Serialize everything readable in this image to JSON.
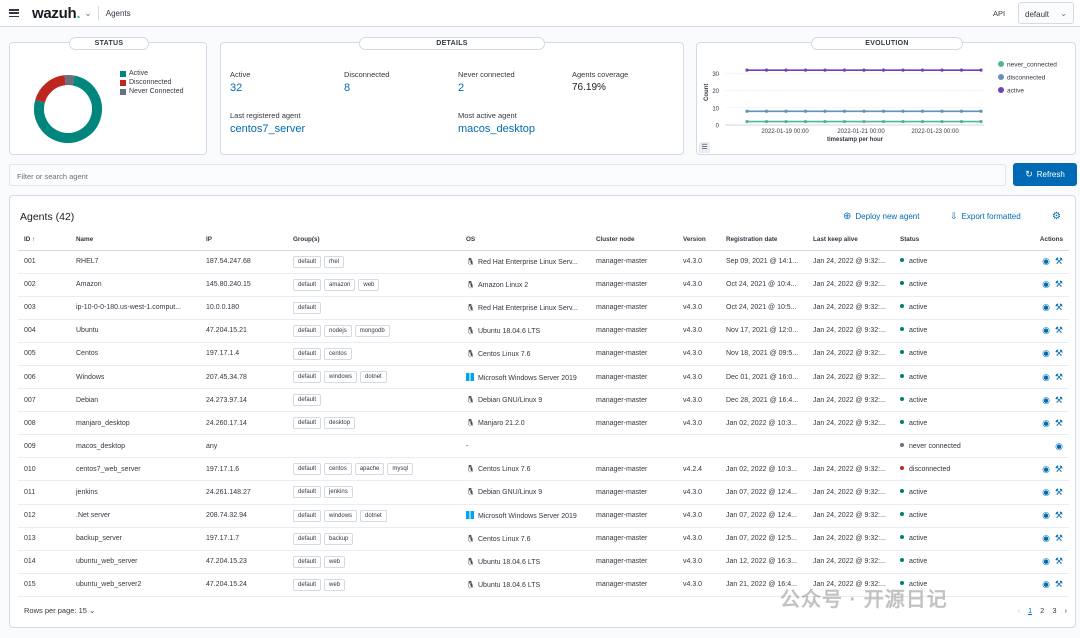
{
  "topbar": {
    "logo_text": "wazuh",
    "logo_dot": ".",
    "breadcrumb": "Agents",
    "api_label": "API",
    "api_value": "default"
  },
  "status": {
    "title": "STATUS",
    "legend": [
      {
        "label": "Active",
        "color": "#00867d",
        "value": 32
      },
      {
        "label": "Disconnected",
        "color": "#bd271e",
        "value": 8
      },
      {
        "label": "Never Connected",
        "color": "#69707d",
        "value": 2
      }
    ]
  },
  "details": {
    "title": "DETAILS",
    "active_label": "Active",
    "active_value": "32",
    "disconnected_label": "Disconnected",
    "disconnected_value": "8",
    "never_label": "Never connected",
    "never_value": "2",
    "coverage_label": "Agents coverage",
    "coverage_value": "76.19%",
    "last_label": "Last registered agent",
    "last_value": "centos7_server",
    "most_label": "Most active agent",
    "most_value": "macos_desktop"
  },
  "evolution": {
    "title": "EVOLUTION",
    "chart_data": {
      "type": "line",
      "ylabel": "Count",
      "xlabel": "timestamp per hour",
      "yticks": [
        0,
        10,
        20,
        30
      ],
      "xticks": [
        "2022-01-19 00:00",
        "2022-01-21 00:00",
        "2022-01-23 00:00"
      ],
      "legend_placement": "right",
      "series": [
        {
          "name": "never_connected",
          "color": "#54b399",
          "values": [
            2,
            2,
            2,
            2,
            2,
            2,
            2,
            2,
            2,
            2,
            2,
            2,
            2
          ]
        },
        {
          "name": "disconnected",
          "color": "#6092c0",
          "values": [
            8,
            8,
            8,
            8,
            8,
            8,
            8,
            8,
            8,
            8,
            8,
            8,
            8
          ]
        },
        {
          "name": "active",
          "color": "#7040b7",
          "values": [
            32,
            32,
            32,
            32,
            32,
            32,
            32,
            32,
            32,
            32,
            32,
            32,
            32
          ]
        }
      ]
    }
  },
  "search": {
    "placeholder": "Filter or search agent"
  },
  "refresh_label": "Refresh",
  "agents": {
    "title": "Agents (42)",
    "deploy_label": "Deploy new agent",
    "export_label": "Export formatted",
    "columns": [
      "ID",
      "Name",
      "IP",
      "Group(s)",
      "OS",
      "Cluster node",
      "Version",
      "Registration date",
      "Last keep alive",
      "Status",
      "Actions"
    ],
    "rows": [
      {
        "id": "001",
        "name": "RHEL7",
        "ip": "187.54.247.68",
        "groups": [
          "default",
          "rhel"
        ],
        "os": "Red Hat Enterprise Linux Serv...",
        "os_icon": "linux",
        "node": "manager-master",
        "version": "v4.3.0",
        "reg": "Sep 09, 2021 @ 14:1...",
        "keep": "Jan 24, 2022 @ 9:32:...",
        "status": "active"
      },
      {
        "id": "002",
        "name": "Amazon",
        "ip": "145.80.240.15",
        "groups": [
          "default",
          "amazon",
          "web"
        ],
        "os": "Amazon Linux 2",
        "os_icon": "linux",
        "node": "manager-master",
        "version": "v4.3.0",
        "reg": "Oct 24, 2021 @ 10:4...",
        "keep": "Jan 24, 2022 @ 9:32:...",
        "status": "active"
      },
      {
        "id": "003",
        "name": "ip-10-0-0-180.us-west-1.comput...",
        "ip": "10.0.0.180",
        "groups": [
          "default"
        ],
        "os": "Red Hat Enterprise Linux Serv...",
        "os_icon": "linux",
        "node": "manager-master",
        "version": "v4.3.0",
        "reg": "Oct 24, 2021 @ 10:5...",
        "keep": "Jan 24, 2022 @ 9:32:...",
        "status": "active"
      },
      {
        "id": "004",
        "name": "Ubuntu",
        "ip": "47.204.15.21",
        "groups": [
          "default",
          "nodejs",
          "mongodb"
        ],
        "os": "Ubuntu 18.04.6 LTS",
        "os_icon": "linux",
        "node": "manager-master",
        "version": "v4.3.0",
        "reg": "Nov 17, 2021 @ 12:0...",
        "keep": "Jan 24, 2022 @ 9:32:...",
        "status": "active"
      },
      {
        "id": "005",
        "name": "Centos",
        "ip": "197.17.1.4",
        "groups": [
          "default",
          "centos"
        ],
        "os": "Centos Linux 7.6",
        "os_icon": "linux",
        "node": "manager-master",
        "version": "v4.3.0",
        "reg": "Nov 18, 2021 @ 09:5...",
        "keep": "Jan 24, 2022 @ 9:32:...",
        "status": "active"
      },
      {
        "id": "006",
        "name": "Windows",
        "ip": "207.45.34.78",
        "groups": [
          "default",
          "windows",
          "dotnet"
        ],
        "os": "Microsoft Windows Server 2019",
        "os_icon": "windows",
        "node": "manager-master",
        "version": "v4.3.0",
        "reg": "Dec 01, 2021 @ 16:0...",
        "keep": "Jan 24, 2022 @ 9:32:...",
        "status": "active"
      },
      {
        "id": "007",
        "name": "Debian",
        "ip": "24.273.97.14",
        "groups": [
          "default"
        ],
        "os": "Debian GNU/Linux 9",
        "os_icon": "linux",
        "node": "manager-master",
        "version": "v4.3.0",
        "reg": "Dec 28, 2021 @ 16:4...",
        "keep": "Jan 24, 2022 @ 9:32:...",
        "status": "active"
      },
      {
        "id": "008",
        "name": "manjaro_desktop",
        "ip": "24.260.17.14",
        "groups": [
          "default",
          "desktop"
        ],
        "os": "Manjaro 21.2.0",
        "os_icon": "linux",
        "node": "manager-master",
        "version": "v4.3.0",
        "reg": "Jan 02, 2022 @ 10:3...",
        "keep": "Jan 24, 2022 @ 9:32:...",
        "status": "active"
      },
      {
        "id": "009",
        "name": "macos_desktop",
        "ip": "any",
        "groups": [],
        "os": "-",
        "os_icon": "",
        "node": "",
        "version": "",
        "reg": "",
        "keep": "",
        "status": "never connected"
      },
      {
        "id": "010",
        "name": "centos7_web_server",
        "ip": "197.17.1.6",
        "groups": [
          "default",
          "centos",
          "apache",
          "mysql"
        ],
        "os": "Centos Linux 7.6",
        "os_icon": "linux",
        "node": "manager-master",
        "version": "v4.2.4",
        "reg": "Jan 02, 2022 @ 10:3...",
        "keep": "Jan 24, 2022 @ 9:32:...",
        "status": "disconnected"
      },
      {
        "id": "011",
        "name": "jenkins",
        "ip": "24.261.148.27",
        "groups": [
          "default",
          "jenkins"
        ],
        "os": "Debian GNU/Linux 9",
        "os_icon": "linux",
        "node": "manager-master",
        "version": "v4.3.0",
        "reg": "Jan 07, 2022 @ 12:4...",
        "keep": "Jan 24, 2022 @ 9:32:...",
        "status": "active"
      },
      {
        "id": "012",
        "name": ".Net server",
        "ip": "208.74.32.94",
        "groups": [
          "default",
          "windows",
          "dotnet"
        ],
        "os": "Microsoft Windows Server 2019",
        "os_icon": "windows",
        "node": "manager-master",
        "version": "v4.3.0",
        "reg": "Jan 07, 2022 @ 12:4...",
        "keep": "Jan 24, 2022 @ 9:32:...",
        "status": "active"
      },
      {
        "id": "013",
        "name": "backup_server",
        "ip": "197.17.1.7",
        "groups": [
          "default",
          "backup"
        ],
        "os": "Centos Linux 7.6",
        "os_icon": "linux",
        "node": "manager-master",
        "version": "v4.3.0",
        "reg": "Jan 07, 2022 @ 12:5...",
        "keep": "Jan 24, 2022 @ 9:32:...",
        "status": "active"
      },
      {
        "id": "014",
        "name": "ubuntu_web_server",
        "ip": "47.204.15.23",
        "groups": [
          "default",
          "web"
        ],
        "os": "Ubuntu 18.04.6 LTS",
        "os_icon": "linux",
        "node": "manager-master",
        "version": "v4.3.0",
        "reg": "Jan 12, 2022 @ 16:3...",
        "keep": "Jan 24, 2022 @ 9:32:...",
        "status": "active"
      },
      {
        "id": "015",
        "name": "ubuntu_web_server2",
        "ip": "47.204.15.24",
        "groups": [
          "default",
          "web"
        ],
        "os": "Ubuntu 18.04.6 LTS",
        "os_icon": "linux",
        "node": "manager-master",
        "version": "v4.3.0",
        "reg": "Jan 21, 2022 @ 16:4...",
        "keep": "Jan 24, 2022 @ 9:32:...",
        "status": "active"
      }
    ],
    "rows_per_page": "Rows per page: 15",
    "pages": [
      "1",
      "2",
      "3"
    ]
  },
  "status_colors": {
    "active": "#017d73",
    "disconnected": "#bd271e",
    "never connected": "#69707d"
  },
  "watermark": "公众号 · 开源日记"
}
